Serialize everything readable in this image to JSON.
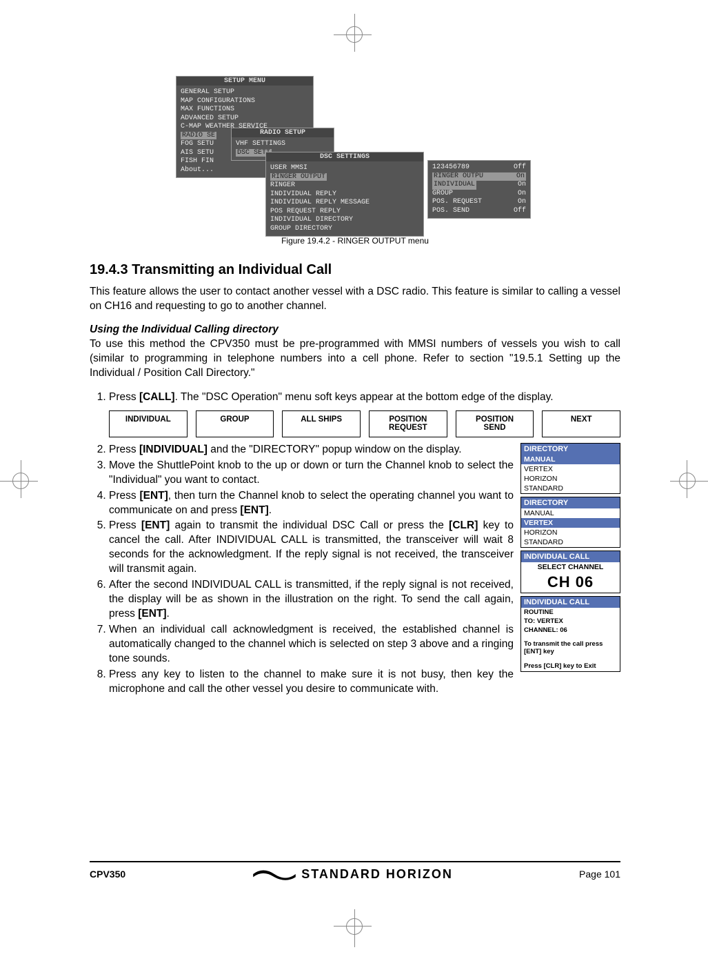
{
  "figure": {
    "setup_menu_title": "SETUP MENU",
    "setup_menu_items": [
      "GENERAL SETUP",
      "MAP CONFIGURATIONS",
      "MAX FUNCTIONS",
      "ADVANCED SETUP",
      "C-MAP WEATHER SERVICE",
      "RADIO SE",
      "FOG SETU",
      "AIS SETU",
      "FISH FIN",
      "About..."
    ],
    "radio_setup_title": "RADIO SETUP",
    "radio_setup_items": [
      "VHF SETTINGS",
      "DSC SETT"
    ],
    "dsc_settings_title": "DSC SETTINGS",
    "dsc_items": [
      "USER MMSI",
      "RINGER OUTPUT",
      "RINGER",
      "INDIVIDUAL REPLY",
      "INDIVIDUAL REPLY MESSAGE",
      "POS REQUEST REPLY",
      "INDIVIDUAL DIRECTORY",
      "GROUP DIRECTORY"
    ],
    "right_title": "123456789",
    "right_off": "Off",
    "ringer_output_title": "RINGER OUTPU",
    "ringer_rows": [
      [
        "INDIVIDUAL",
        "On"
      ],
      [
        "GROUP",
        "On"
      ],
      [
        "POS. REQUEST",
        "On"
      ],
      [
        "POS. SEND",
        "Off"
      ]
    ],
    "caption": "Figure 19.4.2 - RINGER OUTPUT menu"
  },
  "section_title": "19.4.3 Transmitting an Individual Call",
  "para1": "This feature allows the user to contact another vessel with a DSC radio. This feature is similar to calling a vessel on CH16 and requesting to go to another channel.",
  "subhead": "Using the Individual Calling directory",
  "para2": "To use this method the CPV350 must be pre-programmed with MMSI numbers of vessels you wish to call (similar to programming in telephone numbers into a cell phone. Refer to section \"19.5.1 Setting up the Individual / Position Call Directory.\"",
  "step1": "Press [CALL]. The \"DSC Operation\" menu soft keys  appear at the bottom edge of the display.",
  "softkeys": [
    "INDIVIDUAL",
    "GROUP",
    "ALL SHIPS",
    "POSITION REQUEST",
    "POSITION SEND",
    "NEXT"
  ],
  "step2": "Press [INDIVIDUAL] and the \"DIRECTORY\" popup window on the display.",
  "step3": "Move the ShuttlePoint knob to the up or down or turn the Channel knob to select the \"Individual\" you want to contact.",
  "step4": "Press [ENT], then turn the Channel knob to select the operating channel you want to communicate on and press [ENT].",
  "step5": "Press [ENT] again to transmit the individual DSC Call or press the [CLR] key to cancel the call. After INDIVIDUAL CALL is transmitted, the transceiver will wait 8 seconds for the acknowledgment. If the reply signal is not received, the transceiver will transmit again.",
  "step6": "After the second INDIVIDUAL CALL is transmitted, if the reply signal is not received, the display will be as shown in the illustration on the right. To send the call again, press [ENT].",
  "step7": "When an individual call acknowledgment is received, the established channel is automatically changed to the channel which is selected on step 3 above and a ringing tone sounds.",
  "step8": "Press any key to listen to the channel to make sure it is not busy, then key the microphone and call the other vessel you desire to communicate with.",
  "box1": {
    "hdr": "DIRECTORY",
    "sel": "MANUAL",
    "lines": [
      "VERTEX",
      "HORIZON",
      "STANDARD"
    ]
  },
  "box2": {
    "hdr": "DIRECTORY",
    "first": "MANUAL",
    "sel": "VERTEX",
    "lines": [
      "HORIZON",
      "STANDARD"
    ]
  },
  "box3": {
    "hdr": "INDIVIDUAL CALL",
    "sub": "SELECT CHANNEL",
    "big": "CH 06"
  },
  "box4": {
    "hdr": "INDIVIDUAL CALL",
    "lines": [
      "ROUTINE",
      "TO: VERTEX",
      "CHANNEL: 06"
    ],
    "note1": "To transmit the call press [ENT] key",
    "note2": "Press [CLR] key to Exit"
  },
  "footer": {
    "model": "CPV350",
    "brand": "STANDARD HORIZON",
    "page": "Page 101"
  }
}
